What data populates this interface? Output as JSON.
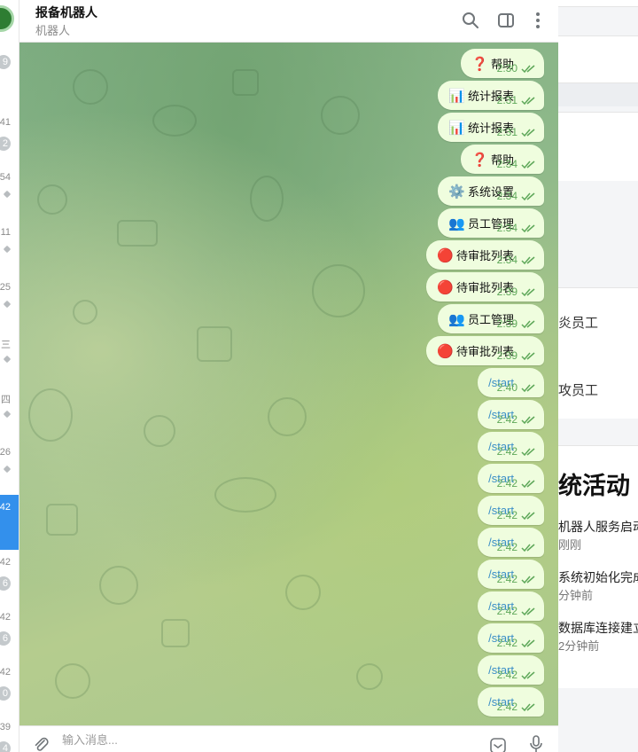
{
  "chat_list": {
    "items": [
      {
        "time": "",
        "badge": "9",
        "pinned": false
      },
      {
        "time": "41",
        "badge": "2",
        "pinned": false
      },
      {
        "time": "54",
        "badge": "",
        "pinned": true
      },
      {
        "time": "11",
        "badge": "",
        "pinned": true
      },
      {
        "time": "25",
        "badge": "",
        "pinned": true
      },
      {
        "time": "三",
        "badge": "",
        "pinned": true
      },
      {
        "time": "四",
        "badge": "",
        "pinned": true
      },
      {
        "time": "26",
        "badge": "",
        "pinned": true
      },
      {
        "time": "42",
        "badge": "",
        "pinned": false,
        "active": true
      },
      {
        "time": "42",
        "badge": "6",
        "pinned": false
      },
      {
        "time": "42",
        "badge": "6",
        "pinned": false
      },
      {
        "time": "42",
        "badge": "0",
        "pinned": false
      },
      {
        "time": "39",
        "badge": "4",
        "pinned": false
      }
    ]
  },
  "chat": {
    "title": "报备机器人",
    "subtitle": "机器人",
    "icons": [
      "search-icon",
      "sidebar-toggle-icon",
      "more-vertical-icon"
    ],
    "composer_placeholder": "输入消息...",
    "messages": [
      {
        "emoji": "❓",
        "text": "帮助",
        "time": "2:30"
      },
      {
        "emoji": "📊",
        "text": "统计报表",
        "time": "2:31"
      },
      {
        "emoji": "📊",
        "text": "统计报表",
        "time": "2:31"
      },
      {
        "emoji": "❓",
        "text": "帮助",
        "time": "2:34"
      },
      {
        "emoji": "⚙️",
        "text": "系统设置",
        "time": "2:34"
      },
      {
        "emoji": "👥",
        "text": "员工管理",
        "time": "2:34"
      },
      {
        "emoji": "🔴",
        "text": "待审批列表",
        "time": "2:34"
      },
      {
        "emoji": "🔴",
        "text": "待审批列表",
        "time": "2:39"
      },
      {
        "emoji": "👥",
        "text": "员工管理",
        "time": "2:39"
      },
      {
        "emoji": "🔴",
        "text": "待审批列表",
        "time": "2:39"
      },
      {
        "emoji": "",
        "text": "/start",
        "time": "2:40"
      },
      {
        "emoji": "",
        "text": "/start",
        "time": "2:42"
      },
      {
        "emoji": "",
        "text": "/start",
        "time": "2:42"
      },
      {
        "emoji": "",
        "text": "/start",
        "time": "2:42"
      },
      {
        "emoji": "",
        "text": "/start",
        "time": "2:42"
      },
      {
        "emoji": "",
        "text": "/start",
        "time": "2:42"
      },
      {
        "emoji": "",
        "text": "/start",
        "time": "2:42"
      },
      {
        "emoji": "",
        "text": "/start",
        "time": "2:42"
      },
      {
        "emoji": "",
        "text": "/start",
        "time": "2:42"
      },
      {
        "emoji": "",
        "text": "/start",
        "time": "2:42"
      },
      {
        "emoji": "",
        "text": "/start",
        "time": "2:42"
      }
    ]
  },
  "dashboard": {
    "stat_label_1": "炎员工",
    "stat_label_2": "攻员工",
    "heading": "统活动",
    "activities": [
      {
        "title": "机器人服务启动",
        "time": "刚刚"
      },
      {
        "title": "系统初始化完成",
        "time": "分钟前"
      },
      {
        "title": "数据库连接建立",
        "time": "2分钟前"
      }
    ]
  },
  "colors": {
    "accent": "#3390ec",
    "bubble": "#effdde",
    "time_green": "#5fa85a",
    "command_blue": "#3a8ec7"
  }
}
